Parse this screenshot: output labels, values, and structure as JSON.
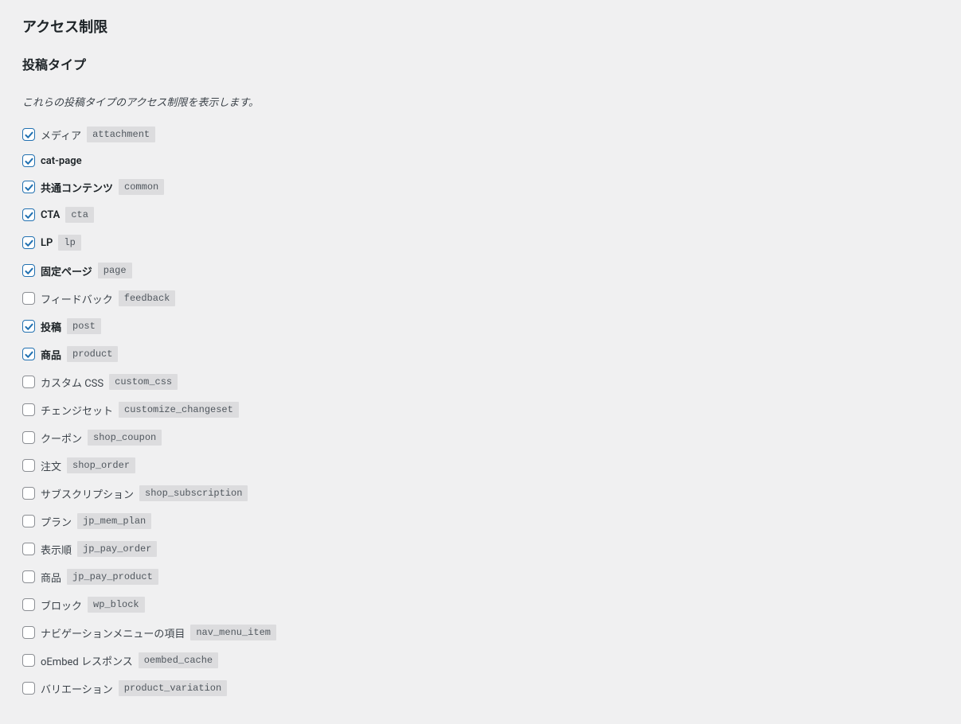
{
  "title": "アクセス制限",
  "subtitle": "投稿タイプ",
  "description": "これらの投稿タイプのアクセス制限を表示します。",
  "items": [
    {
      "label": "メディア",
      "slug": "attachment",
      "checked": true,
      "bold": false
    },
    {
      "label": "cat-page",
      "slug": "",
      "checked": true,
      "bold": true
    },
    {
      "label": "共通コンテンツ",
      "slug": "common",
      "checked": true,
      "bold": true
    },
    {
      "label": "CTA",
      "slug": "cta",
      "checked": true,
      "bold": true
    },
    {
      "label": "LP",
      "slug": "lp",
      "checked": true,
      "bold": true
    },
    {
      "label": "固定ページ",
      "slug": "page",
      "checked": true,
      "bold": true
    },
    {
      "label": "フィードバック",
      "slug": "feedback",
      "checked": false,
      "bold": false
    },
    {
      "label": "投稿",
      "slug": "post",
      "checked": true,
      "bold": true
    },
    {
      "label": "商品",
      "slug": "product",
      "checked": true,
      "bold": true
    },
    {
      "label": "カスタム CSS",
      "slug": "custom_css",
      "checked": false,
      "bold": false
    },
    {
      "label": "チェンジセット",
      "slug": "customize_changeset",
      "checked": false,
      "bold": false
    },
    {
      "label": "クーポン",
      "slug": "shop_coupon",
      "checked": false,
      "bold": false
    },
    {
      "label": "注文",
      "slug": "shop_order",
      "checked": false,
      "bold": false
    },
    {
      "label": "サブスクリプション",
      "slug": "shop_subscription",
      "checked": false,
      "bold": false
    },
    {
      "label": "プラン",
      "slug": "jp_mem_plan",
      "checked": false,
      "bold": false
    },
    {
      "label": "表示順",
      "slug": "jp_pay_order",
      "checked": false,
      "bold": false
    },
    {
      "label": "商品",
      "slug": "jp_pay_product",
      "checked": false,
      "bold": false
    },
    {
      "label": "ブロック",
      "slug": "wp_block",
      "checked": false,
      "bold": false
    },
    {
      "label": "ナビゲーションメニューの項目",
      "slug": "nav_menu_item",
      "checked": false,
      "bold": false
    },
    {
      "label": "oEmbed レスポンス",
      "slug": "oembed_cache",
      "checked": false,
      "bold": false
    },
    {
      "label": "バリエーション",
      "slug": "product_variation",
      "checked": false,
      "bold": false
    }
  ]
}
